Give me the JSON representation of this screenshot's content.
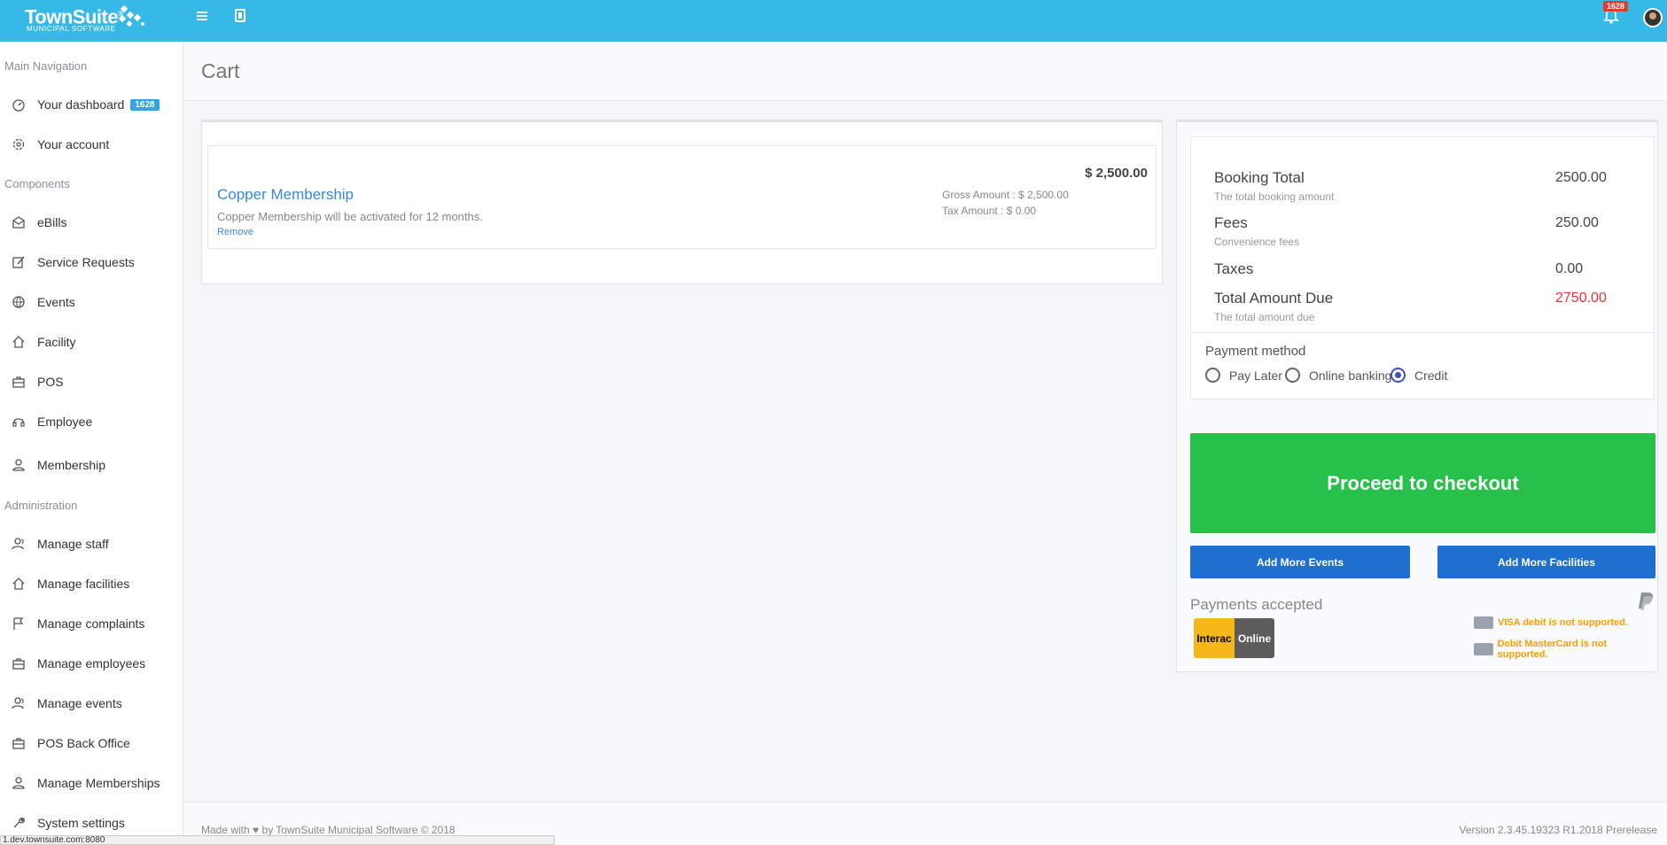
{
  "app": {
    "brand_name": "TownSuite",
    "brand_sub": "MUNICIPAL SOFTWARE",
    "accent": "#36b9e6",
    "notifications_count": "1628"
  },
  "sidebar": {
    "sections": [
      {
        "title": "Main Navigation",
        "items": [
          {
            "label": "Your dashboard",
            "icon": "dashboard-icon",
            "badge": "1628"
          },
          {
            "label": "Your account",
            "icon": "gear-icon"
          }
        ]
      },
      {
        "title": "Components",
        "items": [
          {
            "label": "eBills",
            "icon": "envelope-icon"
          },
          {
            "label": "Service Requests",
            "icon": "edit-icon"
          },
          {
            "label": "Events",
            "icon": "basketball-icon"
          },
          {
            "label": "Facility",
            "icon": "home-icon"
          },
          {
            "label": "POS",
            "icon": "briefcase-icon"
          },
          {
            "label": "Employee",
            "icon": "headset-icon"
          },
          {
            "label": "Membership",
            "icon": "user-icon"
          }
        ]
      },
      {
        "title": "Administration",
        "items": [
          {
            "label": "Manage staff",
            "icon": "users-icon"
          },
          {
            "label": "Manage facilities",
            "icon": "home-icon"
          },
          {
            "label": "Manage complaints",
            "icon": "flag-icon"
          },
          {
            "label": "Manage employees",
            "icon": "briefcase-icon"
          },
          {
            "label": "Manage events",
            "icon": "users-icon"
          },
          {
            "label": "POS Back Office",
            "icon": "briefcase-icon"
          },
          {
            "label": "Manage Memberships",
            "icon": "user-icon"
          },
          {
            "label": "System settings",
            "icon": "wrench-icon"
          }
        ]
      }
    ]
  },
  "page": {
    "title": "Cart"
  },
  "cart": {
    "items": [
      {
        "title": "Copper Membership",
        "description": "Copper Membership will be activated for 12 months.",
        "remove_label": "Remove",
        "price": "$ 2,500.00",
        "gross": "Gross Amount : $ 2,500.00",
        "tax": "Tax Amount : $ 0.00"
      }
    ]
  },
  "summary": {
    "booking_total_label": "Booking Total",
    "booking_total_sub": "The total booking amount",
    "booking_total_value": "2500.00",
    "fees_label": "Fees",
    "fees_sub": "Convenience fees",
    "fees_value": "250.00",
    "taxes_label": "Taxes",
    "taxes_value": "0.00",
    "total_label": "Total Amount Due",
    "total_sub": "The total amount due",
    "total_value": "2750.00",
    "total_color": "#e53935",
    "payment_method_label": "Payment method",
    "payment_options": [
      {
        "label": "Pay Later",
        "selected": false
      },
      {
        "label": "Online banking",
        "selected": false
      },
      {
        "label": "Credit",
        "selected": true
      }
    ]
  },
  "actions": {
    "checkout_label": "Proceed to checkout",
    "checkout_color": "#26c04b",
    "add_events_label": "Add More Events",
    "add_facilities_label": "Add More Facilities"
  },
  "payments": {
    "title": "Payments accepted",
    "interac_left": "Interac",
    "interac_right": "Online",
    "visa_note": "VISA debit is not supported.",
    "mc_note": "Debit MasterCard is not supported.",
    "warn_color": "#f59e0b"
  },
  "footer": {
    "left_prefix": "Made with",
    "left_suffix": "by TownSuite Municipal Software © 2018",
    "version": "Version 2.3.45.19323 R1.2018 Prerelease"
  },
  "status_bar": {
    "url": "1.dev.townsuite.com:8080"
  }
}
